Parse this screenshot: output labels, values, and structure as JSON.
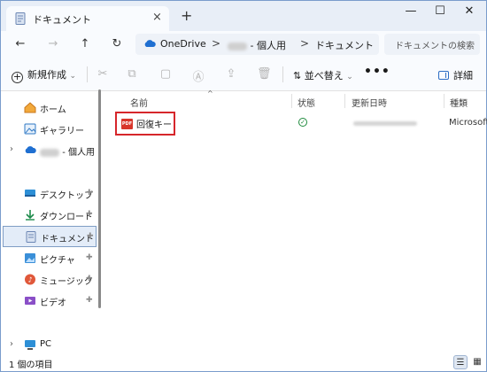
{
  "window": {
    "tab_title": "ドキュメント",
    "tab_close_label": "×",
    "new_tab_label": "+",
    "minimize_label": "—",
    "maximize_label": "☐",
    "close_label": "✕"
  },
  "nav": {
    "back_icon": "←",
    "forward_icon": "→",
    "up_icon": "↑",
    "refresh_icon": "↻",
    "breadcrumb": {
      "onedrive": "OneDrive",
      "personal": "- 個人用",
      "documents": "ドキュメント",
      "separator": ">"
    },
    "search_placeholder": "ドキュメントの検索"
  },
  "toolbar": {
    "new_label": "新規作成",
    "new_chevron": "⌄",
    "sort_label": "並べ替え",
    "sort_chevron": "⌄",
    "more_label": "•••",
    "details_label": "詳細",
    "icons": [
      "cut-icon",
      "copy-icon",
      "paste-icon",
      "rename-icon",
      "share-icon",
      "delete-icon"
    ]
  },
  "sidebar": {
    "items": [
      {
        "label": "ホーム",
        "icon": "home-icon"
      },
      {
        "label": "ギャラリー",
        "icon": "gallery-icon"
      },
      {
        "label": "- 個人用",
        "icon": "onedrive-icon"
      },
      {
        "label": "デスクトップ",
        "icon": "desktop-icon"
      },
      {
        "label": "ダウンロード",
        "icon": "download-icon"
      },
      {
        "label": "ドキュメント",
        "icon": "document-icon"
      },
      {
        "label": "ピクチャ",
        "icon": "pictures-icon"
      },
      {
        "label": "ミュージック",
        "icon": "music-icon"
      },
      {
        "label": "ビデオ",
        "icon": "video-icon"
      },
      {
        "label": "PC",
        "icon": "pc-icon"
      }
    ],
    "chevron": "›",
    "pin_glyph": "📌"
  },
  "columns": {
    "name": "名前",
    "status": "状態",
    "modified": "更新日時",
    "type": "種類"
  },
  "files": [
    {
      "name": "回復キー",
      "icon_text": "PDF",
      "status": "✓",
      "type": "Microsoft E"
    }
  ],
  "statusbar": {
    "count": "1 個の項目",
    "details_view_icon": "☰",
    "tiles_view_icon": "▦"
  },
  "colors": {
    "accent": "#2b6cc4",
    "highlight_border": "#d6262b",
    "status_synced": "#1e8a3c",
    "pdf_red": "#d8352a",
    "selected_bg": "#e3ecf8"
  }
}
